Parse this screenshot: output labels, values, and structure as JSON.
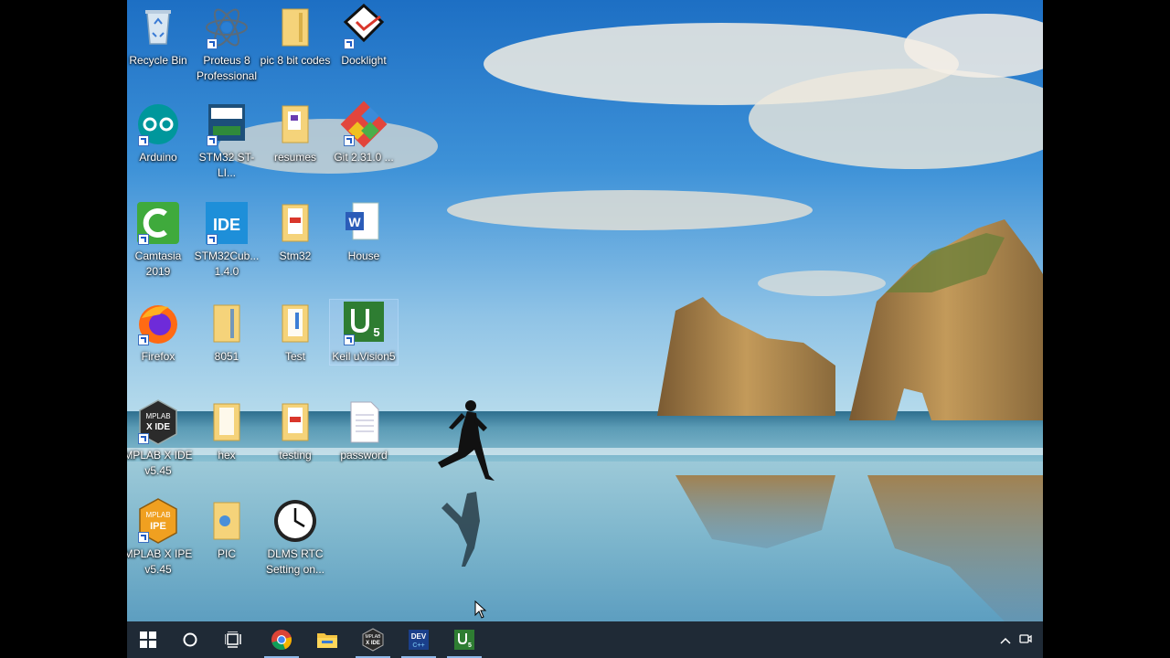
{
  "desktop": {
    "icons": [
      {
        "label": "Recycle Bin",
        "icon": "recycle-bin-icon"
      },
      {
        "label": "Proteus 8 Professional",
        "icon": "proteus-icon"
      },
      {
        "label": "pic 8 bit codes",
        "icon": "folder-icon"
      },
      {
        "label": "Docklight",
        "icon": "docklight-icon"
      },
      {
        "label": "Arduino",
        "icon": "arduino-icon"
      },
      {
        "label": "STM32 ST-LI...",
        "icon": "stlink-icon"
      },
      {
        "label": "resumes",
        "icon": "folder-icon"
      },
      {
        "label": "Git 2.31.0 ...",
        "icon": "git-icon"
      },
      {
        "label": "Camtasia 2019",
        "icon": "camtasia-icon"
      },
      {
        "label": "STM32Cub... 1.4.0",
        "icon": "stm32cube-ide-icon"
      },
      {
        "label": "Stm32",
        "icon": "folder-pdf-icon"
      },
      {
        "label": "House",
        "icon": "word-document-icon"
      },
      {
        "label": "Firefox",
        "icon": "firefox-icon"
      },
      {
        "label": "8051",
        "icon": "folder-icon"
      },
      {
        "label": "Test",
        "icon": "folder-icon"
      },
      {
        "label": "Keil uVision5",
        "icon": "keil-icon"
      },
      {
        "label": "MPLAB X IDE v5.45",
        "icon": "mplab-ide-icon"
      },
      {
        "label": "hex",
        "icon": "folder-icon"
      },
      {
        "label": "testing",
        "icon": "folder-pdf-icon"
      },
      {
        "label": "password",
        "icon": "text-file-icon"
      },
      {
        "label": "MPLAB X IPE v5.45",
        "icon": "mplab-ipe-icon"
      },
      {
        "label": "PIC",
        "icon": "folder-icon"
      },
      {
        "label": "DLMS RTC Setting on...",
        "icon": "clock-icon"
      }
    ]
  },
  "taskbar": {
    "mplab_text": "MPLAB X IDE",
    "dev_text": "DEV C++",
    "keil_text": "μV5"
  },
  "colors": {
    "taskbar": "#1f2a36",
    "active_indicator": "#8fb8e8"
  }
}
